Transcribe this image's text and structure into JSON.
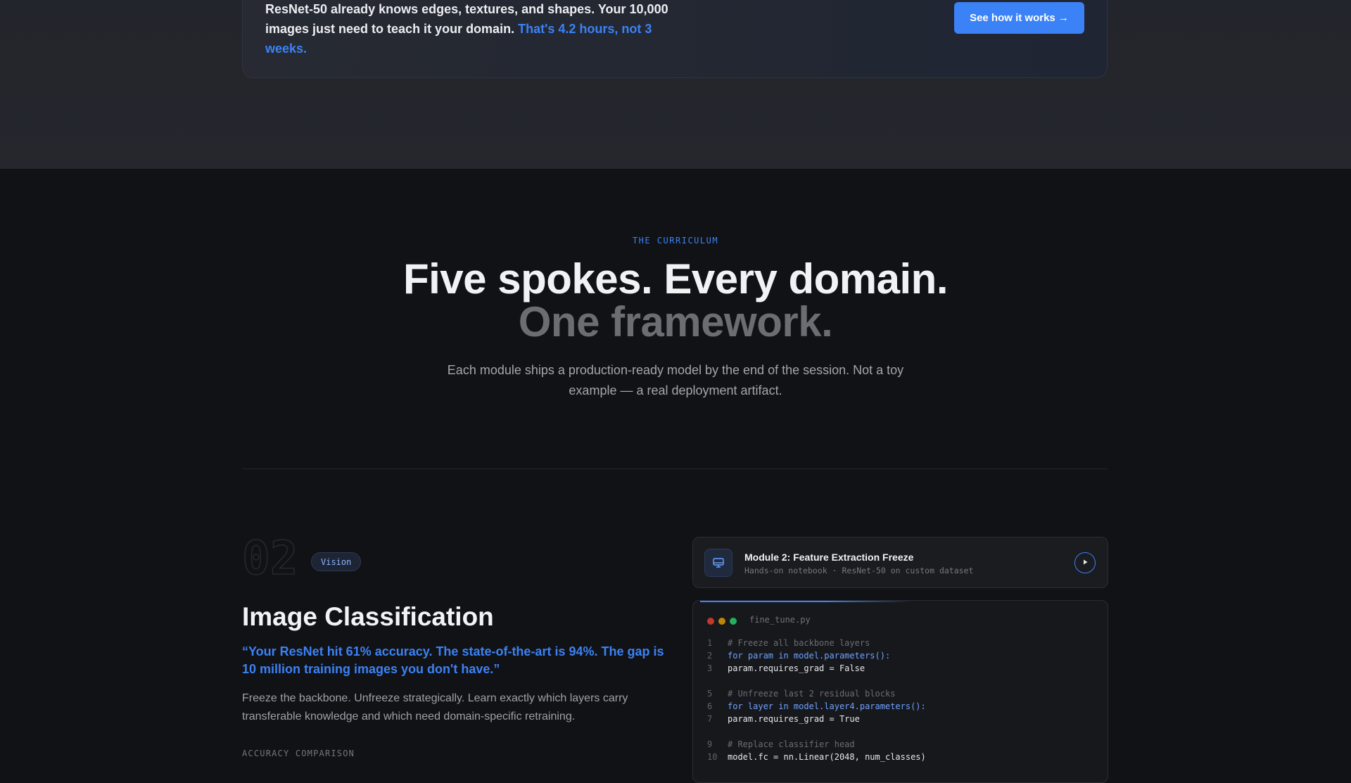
{
  "cta": {
    "text_main": "ResNet-50 already knows edges, textures, and shapes. Your 10,000 images just need to teach it your domain.",
    "text_accent": "That's 4.2 hours, not 3 weeks.",
    "button_label": "See how it works →"
  },
  "curriculum": {
    "eyebrow": "THE CURRICULUM",
    "headline_main": "Five spokes. Every domain.",
    "headline_muted": "One framework.",
    "subhead": "Each module ships a production-ready model by the end of the session. Not a toy example — a real deployment artifact."
  },
  "module": {
    "number": "02",
    "tag": "Vision",
    "title": "Image Classification",
    "quote": "“Your ResNet hit 61% accuracy. The state-of-the-art is 94%. The gap is 10 million training images you don't have.”",
    "description": "Freeze the backbone. Unfreeze strategically. Learn exactly which layers carry transferable knowledge and which need domain-specific retraining.",
    "accuracy_label": "ACCURACY COMPARISON"
  },
  "notebook": {
    "icon": "monitor-icon",
    "title": "Module 2: Feature Extraction Freeze",
    "subtitle": "Hands-on notebook · ResNet-50 on custom dataset",
    "play_icon": "play-icon"
  },
  "code": {
    "filename": "fine_tune.py",
    "dot_colors": [
      "#c0392b",
      "#b8860b",
      "#27ae60"
    ],
    "lines": [
      {
        "n": "1",
        "text": "# Freeze all backbone layers",
        "kind": "comment"
      },
      {
        "n": "2",
        "text": "for param in model.parameters():",
        "kind": "keyword"
      },
      {
        "n": "3",
        "text": "param.requires_grad = False",
        "kind": "plain"
      },
      {
        "n": "",
        "text": "",
        "kind": "plain"
      },
      {
        "n": "5",
        "text": "# Unfreeze last 2 residual blocks",
        "kind": "comment"
      },
      {
        "n": "6",
        "text": "for layer in model.layer4.parameters():",
        "kind": "keyword"
      },
      {
        "n": "7",
        "text": "param.requires_grad = True",
        "kind": "plain"
      },
      {
        "n": "",
        "text": "",
        "kind": "plain"
      },
      {
        "n": "9",
        "text": "# Replace classifier head",
        "kind": "comment"
      },
      {
        "n": "10",
        "text": "model.fc = nn.Linear(2048, num_classes)",
        "kind": "plain"
      }
    ]
  },
  "colors": {
    "accent": "#3b82f6",
    "background": "#111215",
    "band": "#25272d"
  }
}
